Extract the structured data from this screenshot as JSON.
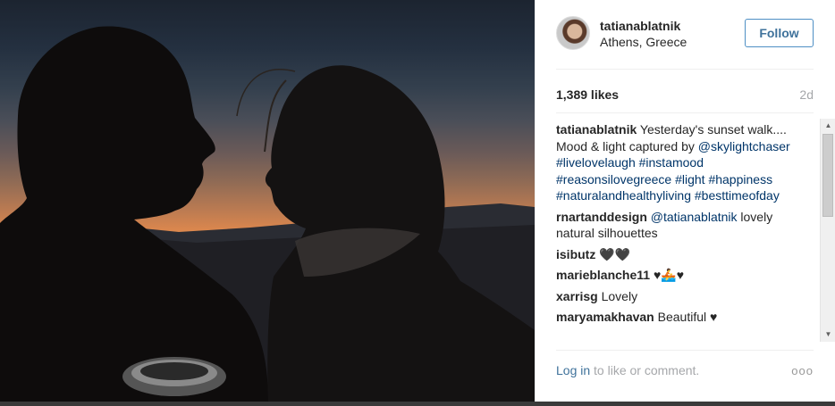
{
  "post": {
    "username": "tatianablatnik",
    "location": "Athens, Greece",
    "follow_label": "Follow",
    "likes": "1,389 likes",
    "age": "2d"
  },
  "caption": {
    "user": "tatianablatnik",
    "text": "Yesterday's sunset walk.... Mood & light captured by",
    "mention": "@skylightchaser",
    "hashtags_1": "#livelovelaugh",
    "hashtags_2": "#instamood #reasonsilovegreece #light",
    "hashtags_3": "#happiness #naturalandhealthyliving",
    "hashtags_4": "#besttimeofday"
  },
  "comments": [
    {
      "user": "rnartanddesign",
      "mention": "@tatianablatnik",
      "text": "lovely natural silhouettes"
    },
    {
      "user": "isibutz",
      "text": "🖤🖤"
    },
    {
      "user": "marieblanche11",
      "text": "♥🚣♥"
    },
    {
      "user": "xarrisg",
      "text": "Lovely"
    },
    {
      "user": "maryamakhavan",
      "text": "Beautiful ♥"
    }
  ],
  "footer": {
    "login_label": "Log in",
    "login_suffix": " to like or comment.",
    "more_icon": "ooo"
  },
  "icons": {
    "more": "more-options-icon",
    "scroll_up": "scroll-up-arrow-icon",
    "scroll_down": "scroll-down-arrow-icon"
  },
  "colors": {
    "accent": "#3f729b",
    "hashtag": "#003569",
    "muted": "#a5a7aa"
  }
}
